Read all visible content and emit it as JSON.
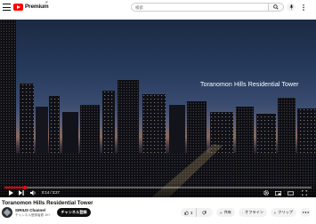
{
  "masthead": {
    "logo_text": "Premium",
    "country_code": "JP",
    "search_placeholder": "検索"
  },
  "player": {
    "overlay_caption": "Toranomon Hills Residential Tower",
    "current_time": "0:14",
    "duration": "3:27",
    "time_display": "0:14 / 3:27",
    "progress_fraction": 0.068
  },
  "video": {
    "title": "Toranomon Hills Residential Tower"
  },
  "channel": {
    "name": "SIRIUS Channel",
    "subscribers": "チャンネル登録者数 1K+",
    "subscribe_label": "チャンネル登録"
  },
  "actions": {
    "like_count": "3",
    "share_label": "共有",
    "offline_label": "オフライン",
    "clip_label": "クリップ"
  },
  "colors": {
    "brand_red": "#ff0000",
    "subscribe_bg": "#0f0f0f",
    "pill_bg": "#f2f2f2"
  },
  "icons": [
    "menu-icon",
    "youtube-logo-icon",
    "search-icon",
    "mic-icon",
    "more-vert-icon",
    "play-icon",
    "next-icon",
    "volume-icon",
    "settings-icon",
    "miniplayer-icon",
    "theater-icon",
    "cast-icon",
    "fullscreen-icon",
    "like-icon",
    "dislike-icon",
    "share-icon",
    "download-icon",
    "clip-icon",
    "more-horiz-icon"
  ]
}
